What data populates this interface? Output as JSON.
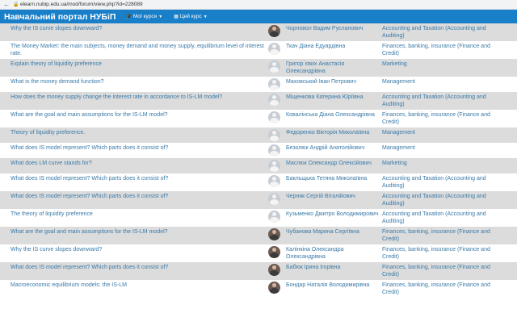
{
  "browser": {
    "url": "elearn.nubip.edu.ua/mod/forum/view.php?id=228089"
  },
  "navbar": {
    "brand": "Навчальний портал НУБіП",
    "my_courses": "Мої курси",
    "this_course": "Цей курс",
    "my_courses_icon": "graduation-cap-icon",
    "this_course_icon": "grid-icon"
  },
  "rows": [
    {
      "subject": "Why the IS curve slopes downward?",
      "author": "Чорновол Вадим Русланович",
      "group": "Accounting and Taxation (Accounting and Auditing)",
      "avatar": "photo"
    },
    {
      "subject": "The Money Market: the main subjects, money demand and money supply, equilibrium level of interest rate.",
      "author": "Ткач Діана Едуардівна",
      "group": "Finances, banking, insurance (Finance and Credit)",
      "avatar": "default"
    },
    {
      "subject": "Explain theory of liquidity preference",
      "author": "Григор`євих Анастасія Олександрівна",
      "group": "Marketing",
      "avatar": "default"
    },
    {
      "subject": "What is the money demand function?",
      "author": "Маховський Іван Петрович",
      "group": "Management",
      "avatar": "default"
    },
    {
      "subject": "How does the money supply change the interest rate in accordance to IS-LM model?",
      "author": "Міщенкова Катерина Юріївна",
      "group": "Accounting and Taxation (Accounting and Auditing)",
      "avatar": "default"
    },
    {
      "subject": "What are the goal and main assumptions for the IS-LM model?",
      "author": "Ковалінська Діана Олександрівна",
      "group": "Finances, banking, insurance (Finance and Credit)",
      "avatar": "default"
    },
    {
      "subject": "Theory of liquidity preference.",
      "author": "Федоренко Вікторія Миколаївна",
      "group": "Management",
      "avatar": "default"
    },
    {
      "subject": "What does IS model represent? Which parts does it consist of?",
      "author": "Безолюк Андрій Анатолійович",
      "group": "Management",
      "avatar": "default"
    },
    {
      "subject": "What does LM curve stands for?",
      "author": "Маслюк Олександр Олексійович",
      "group": "Marketing",
      "avatar": "default"
    },
    {
      "subject": "What does IS model represent? Which parts does it consist of?",
      "author": "Бакльщька Тетяна Миколаївна",
      "group": "Accounting and Taxation (Accounting and Auditing)",
      "avatar": "default"
    },
    {
      "subject": "What does IS model represent? Which parts does it consist of?",
      "author": "Черняк Сергій Віталійович",
      "group": "Accounting and Taxation (Accounting and Auditing)",
      "avatar": "default"
    },
    {
      "subject": "The theory of liquidity preference",
      "author": "Кузьменко Дмитро Володимирович",
      "group": "Accounting and Taxation (Accounting and Auditing)",
      "avatar": "default"
    },
    {
      "subject": "What are the goal and main assumptions for the IS-LM model?",
      "author": "Чубанова Марина Сергіївна",
      "group": "Finances, banking, insurance (Finance and Credit)",
      "avatar": "photo"
    },
    {
      "subject": "Why the IS curve slopes downward?",
      "author": "Калінкіна Олександра Олександрівна",
      "group": "Finances, banking, insurance (Finance and Credit)",
      "avatar": "photo"
    },
    {
      "subject": "What does IS model represent? Which parts does it consist of?",
      "author": "Бабюк Ірина Ігорівна",
      "group": "Finances, banking, insurance (Finance and Credit)",
      "avatar": "photo"
    },
    {
      "subject": "Macroeconomic equilibrium models: the IS-LM",
      "author": "Бондар Наталія Володимирівна",
      "group": "Finances, banking, insurance (Finance and Credit)",
      "avatar": "photo"
    }
  ]
}
